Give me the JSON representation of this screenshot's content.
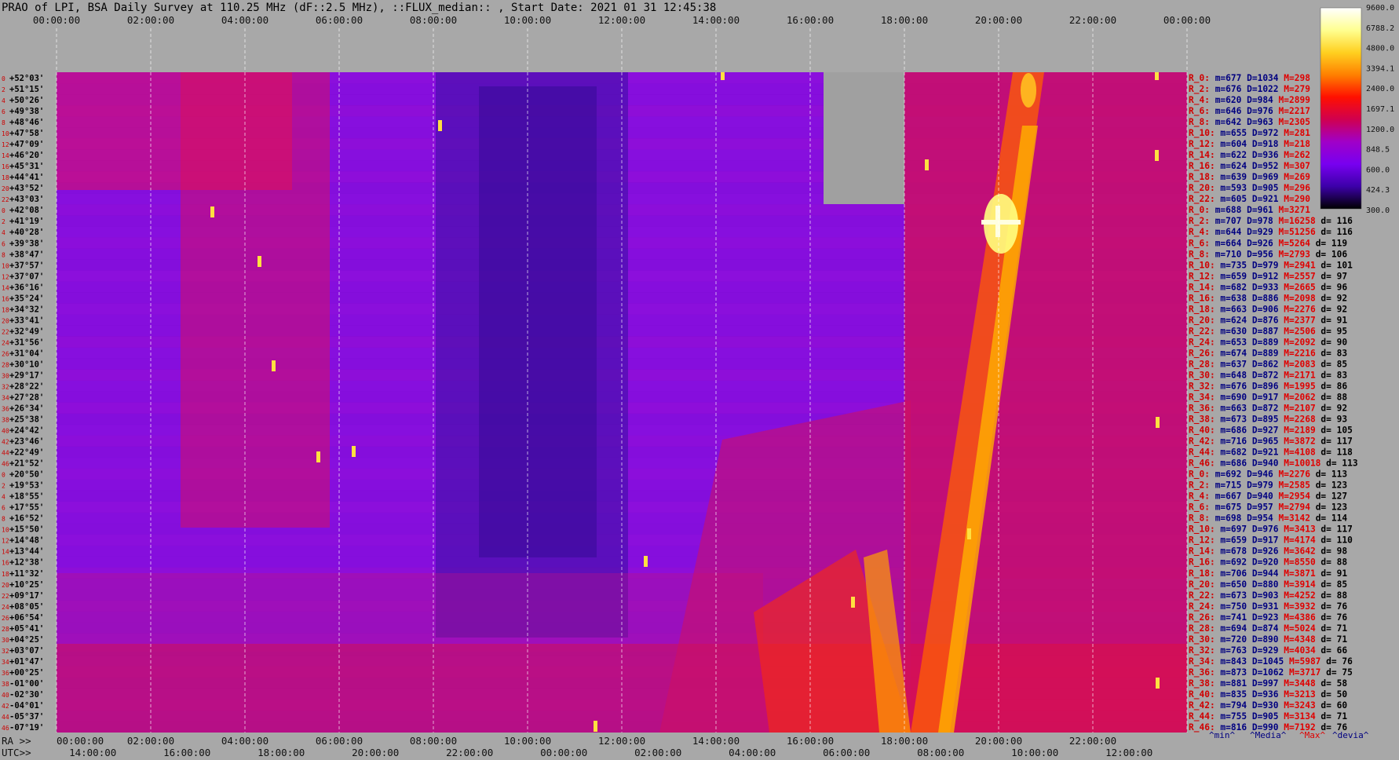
{
  "chart_data": {
    "type": "heatmap",
    "title": "PRAO of LPI, BSA Daily Survey at 110.25 MHz (dF::2.5 MHz), ::FLUX_median:: , Start Date: 2021 01 31 12:45:38",
    "top_time_ticks": [
      "00:00:00",
      "02:00:00",
      "04:00:00",
      "06:00:00",
      "08:00:00",
      "10:00:00",
      "12:00:00",
      "14:00:00",
      "16:00:00",
      "18:00:00",
      "20:00:00",
      "22:00:00",
      "00:00:00"
    ],
    "ra_label": "RA >>",
    "ra_ticks": [
      "00:00:00",
      "02:00:00",
      "04:00:00",
      "06:00:00",
      "08:00:00",
      "10:00:00",
      "12:00:00",
      "14:00:00",
      "16:00:00",
      "18:00:00",
      "20:00:00",
      "22:00:00"
    ],
    "utc_label": "UTC>>",
    "utc_ticks": [
      "14:00:00",
      "16:00:00",
      "18:00:00",
      "20:00:00",
      "22:00:00",
      "00:00:00",
      "02:00:00",
      "04:00:00",
      "06:00:00",
      "08:00:00",
      "10:00:00",
      "12:00:00"
    ],
    "colorbar": {
      "ticks": [
        "9600.0",
        "6788.2",
        "4800.0",
        "3394.1",
        "2400.0",
        "1697.1",
        "1200.0",
        "848.5",
        "600.0",
        "424.3",
        "300.0"
      ],
      "colors": [
        "#ffffff",
        "#ffff90",
        "#ffd020",
        "#ff8000",
        "#ff1000",
        "#d00050",
        "#a000c8",
        "#7800f0",
        "#3c00a8",
        "#000000"
      ]
    },
    "declinations": [
      "+52°03'",
      "+51°15'",
      "+50°26'",
      "+49°38'",
      "+48°46'",
      "+47°58'",
      "+47°09'",
      "+46°20'",
      "+45°31'",
      "+44°41'",
      "+43°52'",
      "+43°03'",
      "+42°08'",
      "+41°19'",
      "+40°28'",
      "+39°38'",
      "+38°47'",
      "+37°57'",
      "+37°07'",
      "+36°16'",
      "+35°24'",
      "+34°32'",
      "+33°41'",
      "+32°49'",
      "+31°56'",
      "+31°04'",
      "+30°10'",
      "+29°17'",
      "+28°22'",
      "+27°28'",
      "+26°34'",
      "+25°38'",
      "+24°42'",
      "+23°46'",
      "+22°49'",
      "+21°52'",
      "+20°50'",
      "+19°53'",
      "+18°55'",
      "+17°55'",
      "+16°52'",
      "+15°50'",
      "+14°48'",
      "+13°44'",
      "+12°38'",
      "+11°32'",
      "+10°25'",
      "+09°17'",
      "+08°05'",
      "+06°54'",
      "+05°41'",
      "+04°25'",
      "+03°07'",
      "+01°47'",
      "+00°25'",
      "-01°00'",
      "-02°30'",
      "-04°01'",
      "-05°37'",
      "-07°19'"
    ],
    "beam_index_labels": [
      "0",
      "2",
      "4",
      "6",
      "8",
      "10",
      "12",
      "14",
      "16",
      "18",
      "20",
      "22",
      "0",
      "2",
      "4",
      "6",
      "8",
      "10",
      "12",
      "14",
      "16",
      "18",
      "20",
      "22",
      "24",
      "26",
      "28",
      "30",
      "32",
      "34",
      "36",
      "38",
      "40",
      "42",
      "44",
      "46",
      "0",
      "2",
      "4",
      "6",
      "8",
      "10",
      "12",
      "14",
      "16",
      "18",
      "20",
      "22",
      "24",
      "26",
      "28",
      "30",
      "32",
      "34",
      "36",
      "38",
      "40",
      "42",
      "44",
      "46"
    ],
    "stats": [
      {
        "r": "R_0:",
        "m": "m=677",
        "D": "D=1034",
        "M": "M=298",
        "d": ""
      },
      {
        "r": "R_2:",
        "m": "m=676",
        "D": "D=1022",
        "M": "M=279",
        "d": ""
      },
      {
        "r": "R_4:",
        "m": "m=620",
        "D": "D=984",
        "M": "M=2899",
        "d": ""
      },
      {
        "r": "R_6:",
        "m": "m=646",
        "D": "D=976",
        "M": "M=2217",
        "d": ""
      },
      {
        "r": "R_8:",
        "m": "m=642",
        "D": "D=963",
        "M": "M=2305",
        "d": ""
      },
      {
        "r": "R_10:",
        "m": "m=655",
        "D": "D=972",
        "M": "M=281",
        "d": ""
      },
      {
        "r": "R_12:",
        "m": "m=604",
        "D": "D=918",
        "M": "M=218",
        "d": ""
      },
      {
        "r": "R_14:",
        "m": "m=622",
        "D": "D=936",
        "M": "M=262",
        "d": ""
      },
      {
        "r": "R_16:",
        "m": "m=624",
        "D": "D=952",
        "M": "M=307",
        "d": ""
      },
      {
        "r": "R_18:",
        "m": "m=639",
        "D": "D=969",
        "M": "M=269",
        "d": ""
      },
      {
        "r": "R_20:",
        "m": "m=593",
        "D": "D=905",
        "M": "M=296",
        "d": ""
      },
      {
        "r": "R_22:",
        "m": "m=605",
        "D": "D=921",
        "M": "M=290",
        "d": ""
      },
      {
        "r": "R_0:",
        "m": "m=688",
        "D": "D=961",
        "M": "M=3271",
        "d": ""
      },
      {
        "r": "R_2:",
        "m": "m=707",
        "D": "D=978",
        "M": "M=16258",
        "d": "d= 116"
      },
      {
        "r": "R_4:",
        "m": "m=644",
        "D": "D=929",
        "M": "M=51256",
        "d": "d= 116"
      },
      {
        "r": "R_6:",
        "m": "m=664",
        "D": "D=926",
        "M": "M=5264",
        "d": "d= 119"
      },
      {
        "r": "R_8:",
        "m": "m=710",
        "D": "D=956",
        "M": "M=2793",
        "d": "d= 106"
      },
      {
        "r": "R_10:",
        "m": "m=735",
        "D": "D=979",
        "M": "M=2941",
        "d": "d= 101"
      },
      {
        "r": "R_12:",
        "m": "m=659",
        "D": "D=912",
        "M": "M=2557",
        "d": "d= 97"
      },
      {
        "r": "R_14:",
        "m": "m=682",
        "D": "D=933",
        "M": "M=2665",
        "d": "d= 96"
      },
      {
        "r": "R_16:",
        "m": "m=638",
        "D": "D=886",
        "M": "M=2098",
        "d": "d= 92"
      },
      {
        "r": "R_18:",
        "m": "m=663",
        "D": "D=906",
        "M": "M=2276",
        "d": "d= 92"
      },
      {
        "r": "R_20:",
        "m": "m=624",
        "D": "D=876",
        "M": "M=2377",
        "d": "d= 91"
      },
      {
        "r": "R_22:",
        "m": "m=630",
        "D": "D=887",
        "M": "M=2506",
        "d": "d= 95"
      },
      {
        "r": "R_24:",
        "m": "m=653",
        "D": "D=889",
        "M": "M=2092",
        "d": "d= 90"
      },
      {
        "r": "R_26:",
        "m": "m=674",
        "D": "D=889",
        "M": "M=2216",
        "d": "d= 83"
      },
      {
        "r": "R_28:",
        "m": "m=637",
        "D": "D=862",
        "M": "M=2083",
        "d": "d= 85"
      },
      {
        "r": "R_30:",
        "m": "m=648",
        "D": "D=872",
        "M": "M=2171",
        "d": "d= 83"
      },
      {
        "r": "R_32:",
        "m": "m=676",
        "D": "D=896",
        "M": "M=1995",
        "d": "d= 86"
      },
      {
        "r": "R_34:",
        "m": "m=690",
        "D": "D=917",
        "M": "M=2062",
        "d": "d= 88"
      },
      {
        "r": "R_36:",
        "m": "m=663",
        "D": "D=872",
        "M": "M=2107",
        "d": "d= 92"
      },
      {
        "r": "R_38:",
        "m": "m=673",
        "D": "D=895",
        "M": "M=2268",
        "d": "d= 93"
      },
      {
        "r": "R_40:",
        "m": "m=686",
        "D": "D=927",
        "M": "M=2189",
        "d": "d= 105"
      },
      {
        "r": "R_42:",
        "m": "m=716",
        "D": "D=965",
        "M": "M=3872",
        "d": "d= 117"
      },
      {
        "r": "R_44:",
        "m": "m=682",
        "D": "D=921",
        "M": "M=4108",
        "d": "d= 118"
      },
      {
        "r": "R_46:",
        "m": "m=686",
        "D": "D=940",
        "M": "M=10018",
        "d": "d= 113"
      },
      {
        "r": "R_0:",
        "m": "m=692",
        "D": "D=946",
        "M": "M=2276",
        "d": "d= 113"
      },
      {
        "r": "R_2:",
        "m": "m=715",
        "D": "D=979",
        "M": "M=2585",
        "d": "d= 123"
      },
      {
        "r": "R_4:",
        "m": "m=667",
        "D": "D=940",
        "M": "M=2954",
        "d": "d= 127"
      },
      {
        "r": "R_6:",
        "m": "m=675",
        "D": "D=957",
        "M": "M=2794",
        "d": "d= 123"
      },
      {
        "r": "R_8:",
        "m": "m=698",
        "D": "D=954",
        "M": "M=3142",
        "d": "d= 114"
      },
      {
        "r": "R_10:",
        "m": "m=697",
        "D": "D=976",
        "M": "M=3413",
        "d": "d= 117"
      },
      {
        "r": "R_12:",
        "m": "m=659",
        "D": "D=917",
        "M": "M=4174",
        "d": "d= 110"
      },
      {
        "r": "R_14:",
        "m": "m=678",
        "D": "D=926",
        "M": "M=3642",
        "d": "d= 98"
      },
      {
        "r": "R_16:",
        "m": "m=692",
        "D": "D=920",
        "M": "M=8550",
        "d": "d= 88"
      },
      {
        "r": "R_18:",
        "m": "m=706",
        "D": "D=944",
        "M": "M=3871",
        "d": "d= 91"
      },
      {
        "r": "R_20:",
        "m": "m=650",
        "D": "D=880",
        "M": "M=3914",
        "d": "d= 85"
      },
      {
        "r": "R_22:",
        "m": "m=673",
        "D": "D=903",
        "M": "M=4252",
        "d": "d= 88"
      },
      {
        "r": "R_24:",
        "m": "m=750",
        "D": "D=931",
        "M": "M=3932",
        "d": "d= 76"
      },
      {
        "r": "R_26:",
        "m": "m=741",
        "D": "D=923",
        "M": "M=4386",
        "d": "d= 76"
      },
      {
        "r": "R_28:",
        "m": "m=694",
        "D": "D=874",
        "M": "M=5024",
        "d": "d= 71"
      },
      {
        "r": "R_30:",
        "m": "m=720",
        "D": "D=890",
        "M": "M=4348",
        "d": "d= 71"
      },
      {
        "r": "R_32:",
        "m": "m=763",
        "D": "D=929",
        "M": "M=4034",
        "d": "d= 66"
      },
      {
        "r": "R_34:",
        "m": "m=843",
        "D": "D=1045",
        "M": "M=5987",
        "d": "d= 76"
      },
      {
        "r": "R_36:",
        "m": "m=873",
        "D": "D=1062",
        "M": "M=3717",
        "d": "d= 75"
      },
      {
        "r": "R_38:",
        "m": "m=881",
        "D": "D=997",
        "M": "M=3448",
        "d": "d= 58"
      },
      {
        "r": "R_40:",
        "m": "m=835",
        "D": "D=936",
        "M": "M=3213",
        "d": "d= 50"
      },
      {
        "r": "R_42:",
        "m": "m=794",
        "D": "D=930",
        "M": "M=3243",
        "d": "d= 60"
      },
      {
        "r": "R_44:",
        "m": "m=755",
        "D": "D=905",
        "M": "M=3134",
        "d": "d= 71"
      },
      {
        "r": "R_46:",
        "m": "m=816",
        "D": "D=990",
        "M": "M=7192",
        "d": "d= 76"
      }
    ],
    "stats_footer": {
      "min": "^min^",
      "median": "^Media^",
      "max": "^Max^",
      "devia": "^devia^"
    },
    "colors": {
      "background": "#a8a8a8",
      "gap": "#a0a0a0",
      "stat_label": "#d00000",
      "stat_value": "#000080",
      "stat_max": "#e00000"
    }
  }
}
